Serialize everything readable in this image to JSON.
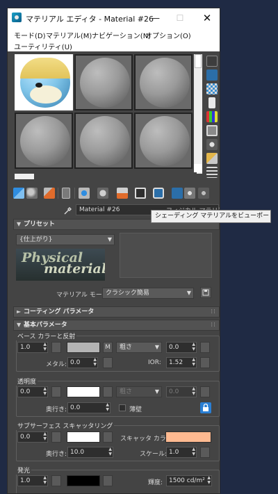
{
  "window": {
    "title": "マテリアル エディタ - Material #26",
    "min_glyph": "—",
    "max_glyph": "☐",
    "close_glyph": "✕"
  },
  "menu": {
    "mode": "モード(D)",
    "material": "マテリアル(M)",
    "navigation": "ナビゲーション(N)",
    "options": "オプション(O)",
    "utilities": "ユーティリティ(U)"
  },
  "slots": {
    "count": 6,
    "active_index": 0
  },
  "right_toolbar": [
    "sample-type-icon",
    "backlight-icon",
    "background-icon",
    "sample-uv-tiling-icon",
    "video-color-check-icon",
    "make-preview-icon",
    "options-icon",
    "select-by-material-icon",
    "material-map-navigator-icon"
  ],
  "bottom_toolbar": [
    "get-material-icon",
    "put-to-scene-icon",
    "assign-to-selection-icon",
    "reset-map-icon",
    "make-unique-icon",
    "put-to-library-icon",
    "material-id-channel-icon",
    "show-shaded-in-viewport-icon",
    "show-end-result-icon",
    "go-to-parent-icon",
    "go-forward-to-sibling-icon"
  ],
  "name_row": {
    "material_name": "Material #26",
    "type_button_partial": "フィジカル マテリアル"
  },
  "tooltip": "シェーディング マテリアルをビューポートに表示",
  "presets": {
    "header": "プリセット",
    "preset_value": "{仕上がり}",
    "logo_line1": "Physical",
    "logo_line2": "material",
    "material_mode_label": "マテリアル モード:",
    "material_mode_value": "クラシック簡易"
  },
  "coating": {
    "header": "コーティング パラメータ"
  },
  "basic": {
    "header": "基本パラメータ",
    "base_color": {
      "group_label": "ベース カラーと反射",
      "weight": "1.0",
      "map_letter": "M",
      "roughness_mode": "粗さ",
      "roughness": "0.0",
      "metalness_label": "メタル:",
      "metalness": "0.0",
      "ior_label": "IOR:",
      "ior": "1.52",
      "color": "#b4b4b4"
    },
    "transparency": {
      "group_label": "透明度",
      "weight": "0.0",
      "roughness_mode": "粗さ",
      "roughness": "0.0",
      "depth_label": "奥行き:",
      "depth": "0.0",
      "thin_walled_label": "薄壁",
      "color": "#ffffff"
    },
    "sss": {
      "group_label": "サブサーフェス スキャッタリング",
      "weight": "0.0",
      "scatter_color_label": "スキャッタ カラー:",
      "scatter_color": "#ffba91",
      "depth_label": "奥行き:",
      "depth": "10.0",
      "scale_label": "スケール:",
      "scale": "1.0",
      "color": "#ffffff"
    },
    "emission": {
      "group_label": "発光",
      "weight": "1.0",
      "luminance_label": "輝度:",
      "luminance": "1500 cd/m²",
      "color": "#000000"
    }
  },
  "ui_colors": {
    "window_bg": "#444444",
    "accent_blue": "#2a7fd4",
    "desktop_bg": "#1f2a44"
  }
}
